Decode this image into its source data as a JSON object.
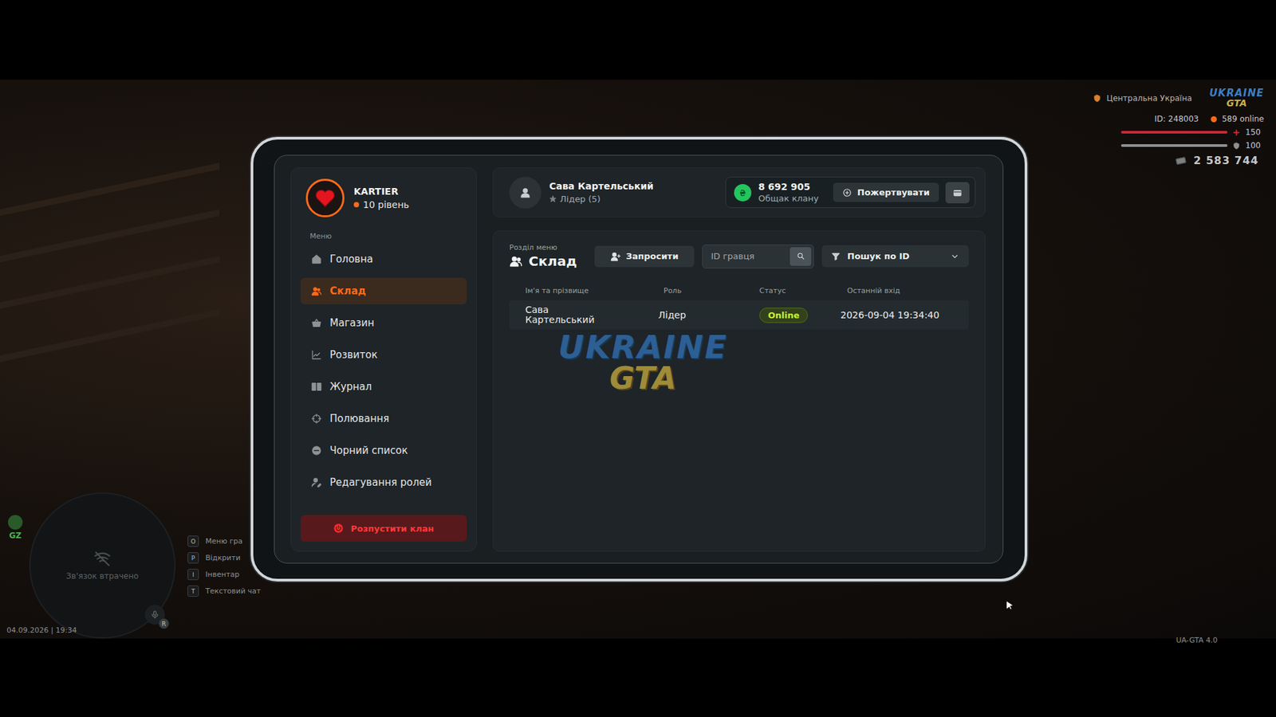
{
  "hud": {
    "region": "Центральна Україна",
    "logo": [
      "UKRAINE",
      "GTA"
    ],
    "id": "ID: 248003",
    "online": "589 online",
    "health": {
      "value": "150",
      "level": 1
    },
    "armor": {
      "value": "100",
      "level": 1
    },
    "money": "2 583 744",
    "gz": "GZ",
    "minimap": "Зв'язок втрачено",
    "mic_key": "R",
    "hints": [
      {
        "key": "O",
        "label": "Меню гра"
      },
      {
        "key": "P",
        "label": "Відкрити"
      },
      {
        "key": "I",
        "label": "Інвентар"
      },
      {
        "key": "T",
        "label": "Текстовий чат"
      }
    ],
    "datetime": "04.09.2026 | 19:34",
    "version": "UA-GTA 4.0"
  },
  "clan": {
    "name": "KARTIER",
    "level": "10 рівень"
  },
  "sidebar": {
    "heading": "Меню",
    "items": [
      {
        "label": "Головна",
        "selected": false
      },
      {
        "label": "Склад",
        "selected": true
      },
      {
        "label": "Магазин",
        "selected": false
      },
      {
        "label": "Розвиток",
        "selected": false
      },
      {
        "label": "Журнал",
        "selected": false
      },
      {
        "label": "Полювання",
        "selected": false
      },
      {
        "label": "Чорний список",
        "selected": false
      },
      {
        "label": "Редагування ролей",
        "selected": false
      }
    ],
    "disband": "Розпустити клан"
  },
  "header": {
    "player": "Сава Картельський",
    "rank": "Лідер (5)",
    "balance": "8 692 905",
    "balance_label": "Общак клану",
    "donate": "Пожертвувати"
  },
  "section": {
    "caption": "Розділ меню",
    "title": "Склад",
    "invite": "Запросити",
    "search_placeholder": "ID гравця",
    "filter": "Пошук по ID"
  },
  "table": {
    "columns": [
      "Ім'я та прізвище",
      "Роль",
      "Статус",
      "Останній вхід"
    ],
    "rows": [
      {
        "name": "Сава Картельський",
        "role": "Лідер",
        "status": "Online",
        "online": true,
        "last": "2026-09-04 19:34:40"
      }
    ]
  },
  "watermark": [
    "UKRAINE",
    "GTA"
  ]
}
